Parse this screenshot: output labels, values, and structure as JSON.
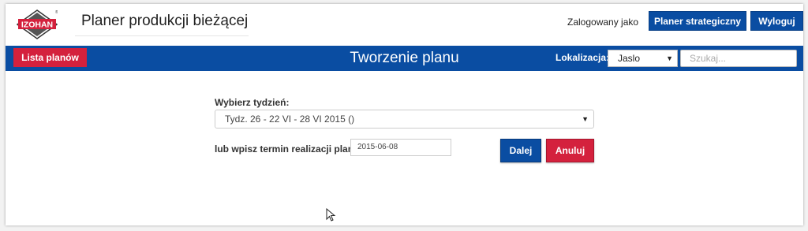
{
  "header": {
    "logo_text": "IZOHAN",
    "app_title": "Planer produkcji bieżącej",
    "logged_as": "Zalogowany jako",
    "strategic_button": "Planer strategiczny",
    "logout_button": "Wyloguj"
  },
  "bar": {
    "plans_button": "Lista planów",
    "title": "Tworzenie planu",
    "location_label": "Lokalizacja:",
    "location_value": "Jaslo",
    "search_placeholder": "Szukaj..."
  },
  "form": {
    "week_label": "Wybierz tydzień:",
    "week_value": "Tydz. 26 - 22 VI - 28 VI 2015 ()",
    "date_label": "lub wpisz termin realizacji planu:",
    "date_value": "2015-06-08",
    "next_button": "Dalej",
    "cancel_button": "Anuluj"
  },
  "colors": {
    "primary": "#0a4da2",
    "danger": "#d4213d"
  }
}
